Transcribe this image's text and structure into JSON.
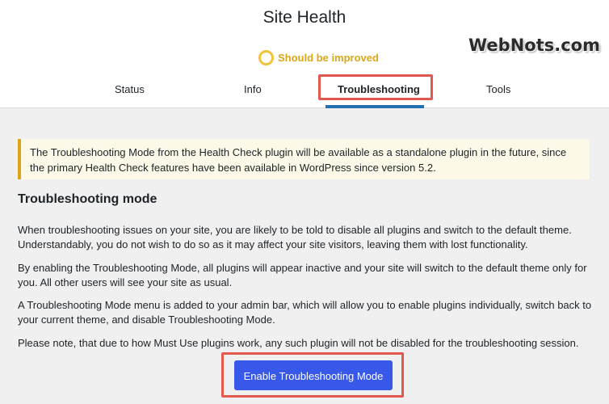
{
  "header": {
    "title": "Site Health",
    "watermark": "WebNots.com",
    "status": {
      "text": "Should be improved",
      "color": "#dba617"
    }
  },
  "tabs": [
    {
      "label": "Status",
      "active": false
    },
    {
      "label": "Info",
      "active": false
    },
    {
      "label": "Troubleshooting",
      "active": true
    },
    {
      "label": "Tools",
      "active": false
    }
  ],
  "notice": {
    "text": "The Troubleshooting Mode from the Health Check plugin will be available as a standalone plugin in the future, since the primary Health Check features have been available in WordPress since version 5.2."
  },
  "section": {
    "heading": "Troubleshooting mode",
    "paragraphs": [
      "When troubleshooting issues on your site, you are likely to be told to disable all plugins and switch to the default theme. Understandably, you do not wish to do so as it may affect your site visitors, leaving them with lost functionality.",
      "By enabling the Troubleshooting Mode, all plugins will appear inactive and your site will switch to the default theme only for you. All other users will see your site as usual.",
      "A Troubleshooting Mode menu is added to your admin bar, which will allow you to enable plugins individually, switch back to your current theme, and disable Troubleshooting Mode.",
      "Please note, that due to how Must Use plugins work, any such plugin will not be disabled for the troubleshooting session."
    ],
    "button_label": "Enable Troubleshooting Mode"
  },
  "colors": {
    "accent_blue": "#3858e9",
    "tab_underline": "#2271b1",
    "highlight_red": "#e4574d",
    "notice_border": "#dba617",
    "notice_bg": "#fcf9e8"
  }
}
